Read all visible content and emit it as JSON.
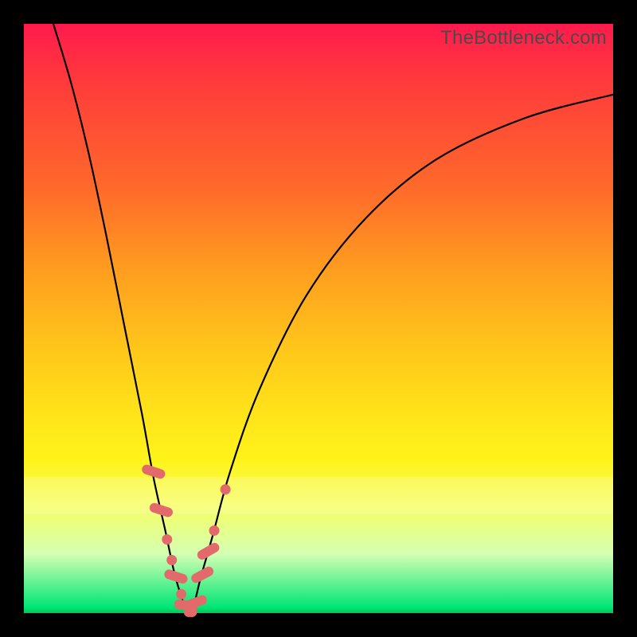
{
  "watermark": "TheBottleneck.com",
  "colors": {
    "frame": "#000000",
    "gradient_top": "#ff1a4d",
    "gradient_bottom": "#00c853",
    "curve": "#000000",
    "markers": "#e26a6a"
  },
  "chart_data": {
    "type": "line",
    "title": "",
    "xlabel": "",
    "ylabel": "",
    "xlim": [
      0,
      100
    ],
    "ylim": [
      0,
      100
    ],
    "series": [
      {
        "name": "bottleneck-curve",
        "x": [
          5,
          8,
          11,
          14,
          17,
          20,
          22,
          24,
          25.5,
          27,
          28,
          29,
          30,
          32,
          35,
          40,
          48,
          58,
          70,
          85,
          100
        ],
        "values": [
          100,
          90,
          78,
          64,
          49,
          34,
          23,
          14,
          7,
          2,
          0,
          2,
          6,
          13,
          24,
          38,
          54,
          67,
          77,
          84,
          88
        ]
      }
    ],
    "markers": {
      "name": "highlighted-points",
      "style": "pill-and-dot",
      "points": [
        {
          "x": 22.0,
          "y": 24.0,
          "shape": "pill",
          "angle": -72
        },
        {
          "x": 23.3,
          "y": 17.5,
          "shape": "pill",
          "angle": -72
        },
        {
          "x": 24.3,
          "y": 12.5,
          "shape": "dot"
        },
        {
          "x": 25.1,
          "y": 9.0,
          "shape": "dot"
        },
        {
          "x": 25.8,
          "y": 6.2,
          "shape": "pill",
          "angle": -72
        },
        {
          "x": 26.7,
          "y": 3.2,
          "shape": "dot"
        },
        {
          "x": 27.5,
          "y": 1.3,
          "shape": "pill",
          "angle": -80
        },
        {
          "x": 28.0,
          "y": 0.2,
          "shape": "dot"
        },
        {
          "x": 28.5,
          "y": 0.2,
          "shape": "dot"
        },
        {
          "x": 29.1,
          "y": 1.8,
          "shape": "pill",
          "angle": 70
        },
        {
          "x": 30.3,
          "y": 6.5,
          "shape": "pill",
          "angle": 62
        },
        {
          "x": 31.3,
          "y": 10.5,
          "shape": "pill",
          "angle": 60
        },
        {
          "x": 32.3,
          "y": 14.0,
          "shape": "dot"
        },
        {
          "x": 34.2,
          "y": 21.0,
          "shape": "dot"
        }
      ]
    },
    "bands": [
      {
        "name": "pale-band",
        "y_from": 17,
        "y_to": 23,
        "opacity": 0.18
      }
    ]
  }
}
